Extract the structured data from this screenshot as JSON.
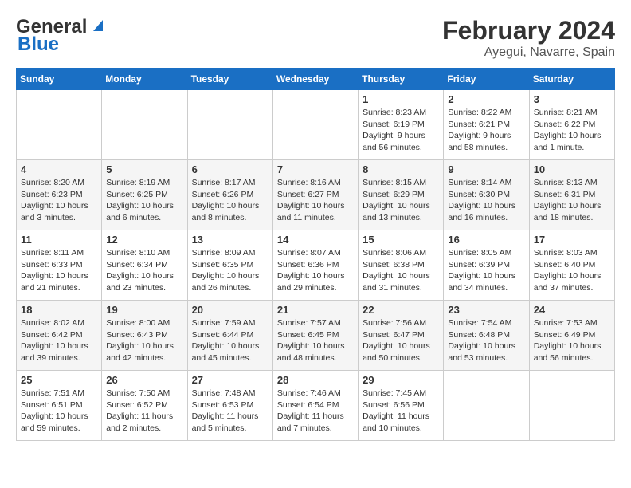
{
  "logo": {
    "line1": "General",
    "line2": "Blue"
  },
  "title": "February 2024",
  "subtitle": "Ayegui, Navarre, Spain",
  "days_of_week": [
    "Sunday",
    "Monday",
    "Tuesday",
    "Wednesday",
    "Thursday",
    "Friday",
    "Saturday"
  ],
  "weeks": [
    [
      {
        "num": "",
        "info": ""
      },
      {
        "num": "",
        "info": ""
      },
      {
        "num": "",
        "info": ""
      },
      {
        "num": "",
        "info": ""
      },
      {
        "num": "1",
        "info": "Sunrise: 8:23 AM\nSunset: 6:19 PM\nDaylight: 9 hours\nand 56 minutes."
      },
      {
        "num": "2",
        "info": "Sunrise: 8:22 AM\nSunset: 6:21 PM\nDaylight: 9 hours\nand 58 minutes."
      },
      {
        "num": "3",
        "info": "Sunrise: 8:21 AM\nSunset: 6:22 PM\nDaylight: 10 hours\nand 1 minute."
      }
    ],
    [
      {
        "num": "4",
        "info": "Sunrise: 8:20 AM\nSunset: 6:23 PM\nDaylight: 10 hours\nand 3 minutes."
      },
      {
        "num": "5",
        "info": "Sunrise: 8:19 AM\nSunset: 6:25 PM\nDaylight: 10 hours\nand 6 minutes."
      },
      {
        "num": "6",
        "info": "Sunrise: 8:17 AM\nSunset: 6:26 PM\nDaylight: 10 hours\nand 8 minutes."
      },
      {
        "num": "7",
        "info": "Sunrise: 8:16 AM\nSunset: 6:27 PM\nDaylight: 10 hours\nand 11 minutes."
      },
      {
        "num": "8",
        "info": "Sunrise: 8:15 AM\nSunset: 6:29 PM\nDaylight: 10 hours\nand 13 minutes."
      },
      {
        "num": "9",
        "info": "Sunrise: 8:14 AM\nSunset: 6:30 PM\nDaylight: 10 hours\nand 16 minutes."
      },
      {
        "num": "10",
        "info": "Sunrise: 8:13 AM\nSunset: 6:31 PM\nDaylight: 10 hours\nand 18 minutes."
      }
    ],
    [
      {
        "num": "11",
        "info": "Sunrise: 8:11 AM\nSunset: 6:33 PM\nDaylight: 10 hours\nand 21 minutes."
      },
      {
        "num": "12",
        "info": "Sunrise: 8:10 AM\nSunset: 6:34 PM\nDaylight: 10 hours\nand 23 minutes."
      },
      {
        "num": "13",
        "info": "Sunrise: 8:09 AM\nSunset: 6:35 PM\nDaylight: 10 hours\nand 26 minutes."
      },
      {
        "num": "14",
        "info": "Sunrise: 8:07 AM\nSunset: 6:36 PM\nDaylight: 10 hours\nand 29 minutes."
      },
      {
        "num": "15",
        "info": "Sunrise: 8:06 AM\nSunset: 6:38 PM\nDaylight: 10 hours\nand 31 minutes."
      },
      {
        "num": "16",
        "info": "Sunrise: 8:05 AM\nSunset: 6:39 PM\nDaylight: 10 hours\nand 34 minutes."
      },
      {
        "num": "17",
        "info": "Sunrise: 8:03 AM\nSunset: 6:40 PM\nDaylight: 10 hours\nand 37 minutes."
      }
    ],
    [
      {
        "num": "18",
        "info": "Sunrise: 8:02 AM\nSunset: 6:42 PM\nDaylight: 10 hours\nand 39 minutes."
      },
      {
        "num": "19",
        "info": "Sunrise: 8:00 AM\nSunset: 6:43 PM\nDaylight: 10 hours\nand 42 minutes."
      },
      {
        "num": "20",
        "info": "Sunrise: 7:59 AM\nSunset: 6:44 PM\nDaylight: 10 hours\nand 45 minutes."
      },
      {
        "num": "21",
        "info": "Sunrise: 7:57 AM\nSunset: 6:45 PM\nDaylight: 10 hours\nand 48 minutes."
      },
      {
        "num": "22",
        "info": "Sunrise: 7:56 AM\nSunset: 6:47 PM\nDaylight: 10 hours\nand 50 minutes."
      },
      {
        "num": "23",
        "info": "Sunrise: 7:54 AM\nSunset: 6:48 PM\nDaylight: 10 hours\nand 53 minutes."
      },
      {
        "num": "24",
        "info": "Sunrise: 7:53 AM\nSunset: 6:49 PM\nDaylight: 10 hours\nand 56 minutes."
      }
    ],
    [
      {
        "num": "25",
        "info": "Sunrise: 7:51 AM\nSunset: 6:51 PM\nDaylight: 10 hours\nand 59 minutes."
      },
      {
        "num": "26",
        "info": "Sunrise: 7:50 AM\nSunset: 6:52 PM\nDaylight: 11 hours\nand 2 minutes."
      },
      {
        "num": "27",
        "info": "Sunrise: 7:48 AM\nSunset: 6:53 PM\nDaylight: 11 hours\nand 5 minutes."
      },
      {
        "num": "28",
        "info": "Sunrise: 7:46 AM\nSunset: 6:54 PM\nDaylight: 11 hours\nand 7 minutes."
      },
      {
        "num": "29",
        "info": "Sunrise: 7:45 AM\nSunset: 6:56 PM\nDaylight: 11 hours\nand 10 minutes."
      },
      {
        "num": "",
        "info": ""
      },
      {
        "num": "",
        "info": ""
      }
    ]
  ]
}
